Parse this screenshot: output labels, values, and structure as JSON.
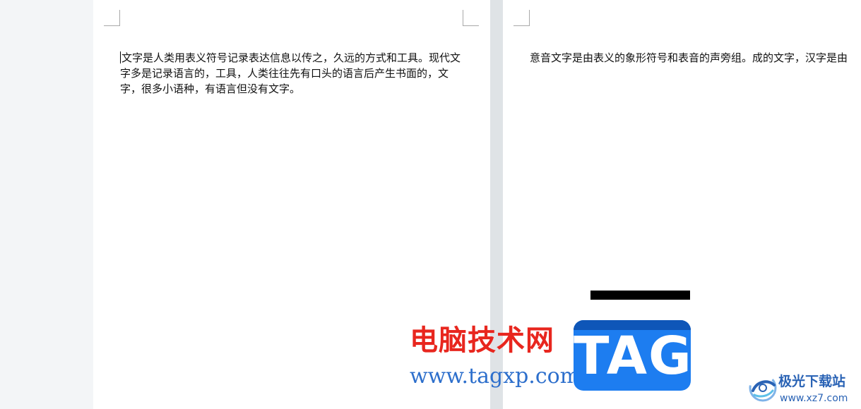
{
  "document": {
    "page1_paragraph": "文字是人类用表义符号记录表达信息以传之，久远的方式和工具。现代文字多是记录语言的，工具，人类往往先有口头的语言后产生书面的，文字，很多小语种，有语言但没有文字。",
    "page2_paragraph": "意音文字是由表义的象形符号和表音的声旁组。成的文字，汉字是由"
  },
  "watermark": {
    "site_name": "电脑技术网",
    "site_url": "www.tagxp.com",
    "tag_label": "TAG",
    "xz_name": "极光下载站",
    "xz_url": "www.xz7.com"
  },
  "colors": {
    "page_background": "#ffffff",
    "workspace_background": "#dfe3e6",
    "watermark_red": "#e8261e",
    "watermark_blue": "#2d6fcc",
    "tag_blue": "#1d7df0"
  }
}
